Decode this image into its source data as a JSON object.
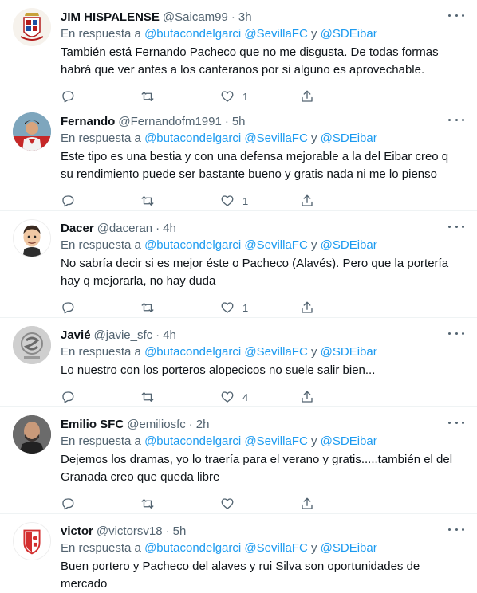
{
  "reply_prefix": "En respuesta a",
  "connector": "y",
  "separator": "·",
  "tweets": [
    {
      "name": "JIM HISPALENSE",
      "handle": "@Saicam99",
      "time": "3h",
      "mentions": [
        "@butacondelgarci",
        "@SevillaFC",
        "@SDEibar"
      ],
      "text": "También está Fernando Pacheco que no me disgusta. De todas formas habrá que ver antes a los canteranos por si alguno es aprovechable.",
      "likes": "1"
    },
    {
      "name": "Fernando",
      "handle": "@Fernandofm1991",
      "time": "5h",
      "mentions": [
        "@butacondelgarci",
        "@SevillaFC",
        "@SDEibar"
      ],
      "text": "Este tipo es una bestia y con una defensa mejorable a la del Eibar creo q su rendimiento puede ser bastante bueno y gratis nada ni me lo pienso",
      "likes": "1"
    },
    {
      "name": "Dacer",
      "handle": "@daceran",
      "time": "4h",
      "mentions": [
        "@butacondelgarci",
        "@SevillaFC",
        "@SDEibar"
      ],
      "text": "No sabría decir si es mejor éste o Pacheco (Alavés). Pero que la portería hay q mejorarla, no hay duda",
      "likes": "1"
    },
    {
      "name": "Javié",
      "handle": "@javie_sfc",
      "time": "4h",
      "mentions": [
        "@butacondelgarci",
        "@SevillaFC",
        "@SDEibar"
      ],
      "text": "Lo nuestro con los porteros alopecicos no suele salir bien...",
      "likes": "4"
    },
    {
      "name": "Emilio SFC",
      "handle": "@emiliosfc",
      "time": "2h",
      "mentions": [
        "@butacondelgarci",
        "@SevillaFC",
        "@SDEibar"
      ],
      "text": "Dejemos los dramas, yo lo traería para el verano y gratis.....también el del Granada creo que queda libre",
      "likes": ""
    },
    {
      "name": "victor",
      "handle": "@victorsv18",
      "time": "5h",
      "mentions": [
        "@butacondelgarci",
        "@SevillaFC",
        "@SDEibar"
      ],
      "text": "Buen portero y Pacheco del alaves y rui Silva son oportunidades de mercado",
      "likes": ""
    }
  ]
}
